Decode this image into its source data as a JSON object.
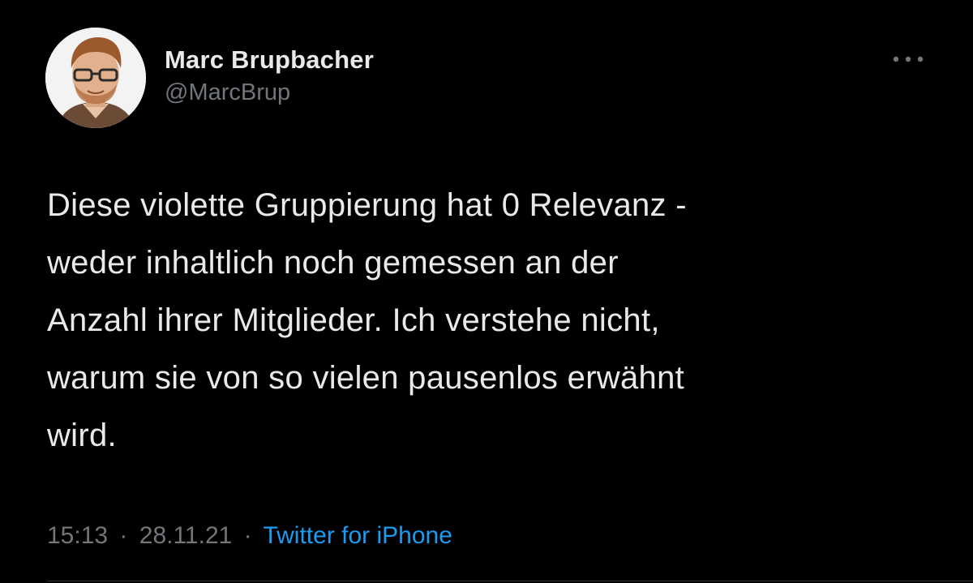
{
  "author": {
    "display_name": "Marc Brupbacher",
    "handle": "@MarcBrup",
    "avatar_icon": "profile-photo"
  },
  "more_icon": "more-horizontal-icon",
  "tweet": {
    "text": "Diese violette Gruppierung hat 0 Relevanz -\nweder inhaltlich noch gemessen an der\nAnzahl ihrer Mitglieder. Ich verstehe nicht,\nwarum sie von so vielen pausenlos erwähnt\nwird."
  },
  "meta": {
    "time": "15:13",
    "separator": "·",
    "date": "28.11.21",
    "source": "Twitter for iPhone"
  },
  "colors": {
    "background": "#000000",
    "text": "#e7e9ea",
    "secondary": "#71767b",
    "link": "#1d9bf0",
    "divider": "#2f3336"
  }
}
